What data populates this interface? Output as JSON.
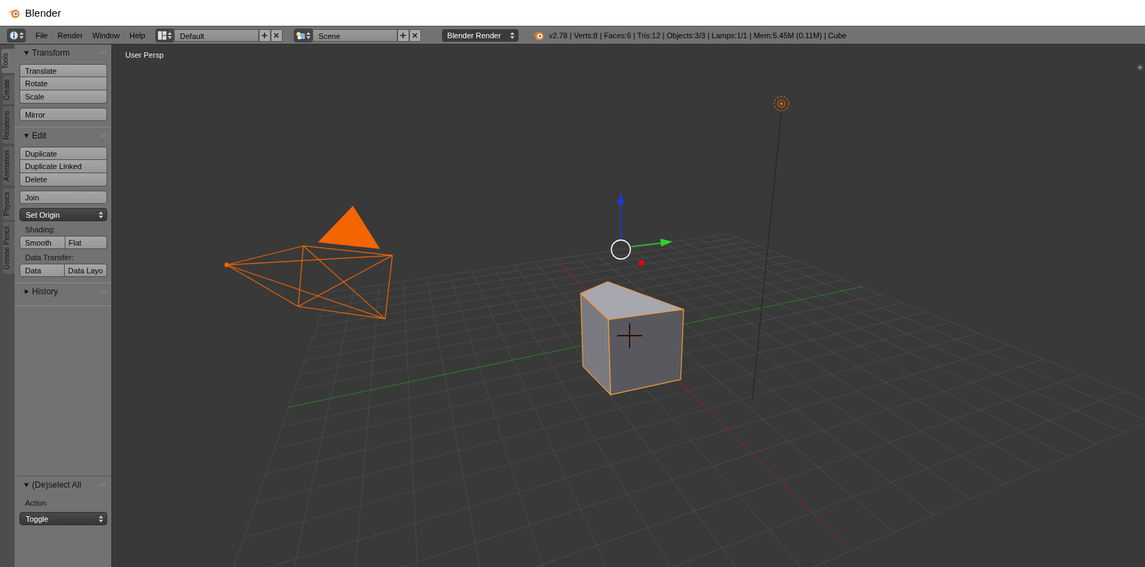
{
  "window": {
    "title": "Blender"
  },
  "header": {
    "menus": [
      "File",
      "Render",
      "Window",
      "Help"
    ],
    "layout": "Default",
    "scene": "Scene",
    "engine": "Blender Render",
    "stats": "v2.78 | Verts:8 | Faces:6 | Tris:12 | Objects:3/3 | Lamps:1/1 | Mem:5.45M (0.11M) | Cube"
  },
  "tool_tabs": [
    {
      "label": "Tools",
      "selected": true
    },
    {
      "label": "Create",
      "selected": false
    },
    {
      "label": "Relations",
      "selected": false
    },
    {
      "label": "Animation",
      "selected": false
    },
    {
      "label": "Physics",
      "selected": false
    },
    {
      "label": "Grease Pencil",
      "selected": false
    }
  ],
  "panels": [
    {
      "title": "Transform",
      "expanded": true,
      "items": [
        {
          "kind": "stack",
          "buttons": [
            "Translate",
            "Rotate",
            "Scale"
          ]
        },
        {
          "kind": "stack",
          "buttons": [
            "Mirror"
          ]
        }
      ]
    },
    {
      "title": "Edit",
      "expanded": true,
      "items": [
        {
          "kind": "stack",
          "buttons": [
            "Duplicate",
            "Duplicate Linked",
            "Delete"
          ]
        },
        {
          "kind": "stack",
          "buttons": [
            "Join"
          ]
        },
        {
          "kind": "dropdown",
          "value": "Set Origin"
        },
        {
          "kind": "label",
          "text": "Shading:"
        },
        {
          "kind": "row",
          "buttons": [
            "Smooth",
            "Flat"
          ]
        },
        {
          "kind": "label",
          "text": "Data Transfer:"
        },
        {
          "kind": "row",
          "buttons": [
            "Data",
            "Data Layo"
          ]
        }
      ]
    },
    {
      "title": "History",
      "expanded": false
    }
  ],
  "operator": {
    "title": "(De)select All",
    "expanded": true,
    "label": "Action",
    "value": "Toggle"
  },
  "viewport": {
    "label": "User Persp"
  }
}
